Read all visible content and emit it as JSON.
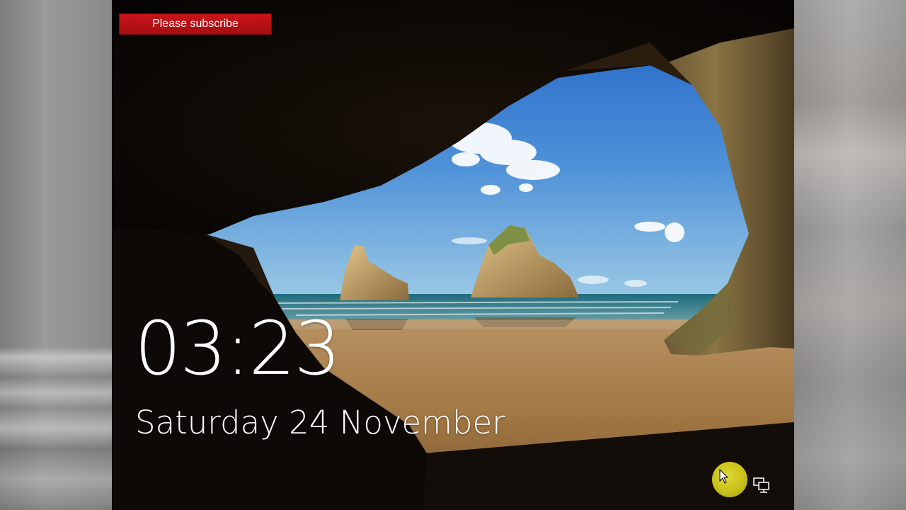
{
  "banner": {
    "label": "Please subscribe",
    "color": "#c8141a"
  },
  "lockscreen": {
    "time": "03:23",
    "date": "Saturday 24 November"
  },
  "icons": {
    "cursor": "mouse-pointer-icon",
    "network": "network-status-icon"
  },
  "colors": {
    "clock_text": "#ffffff",
    "cursor_highlight": "#e2da25"
  }
}
